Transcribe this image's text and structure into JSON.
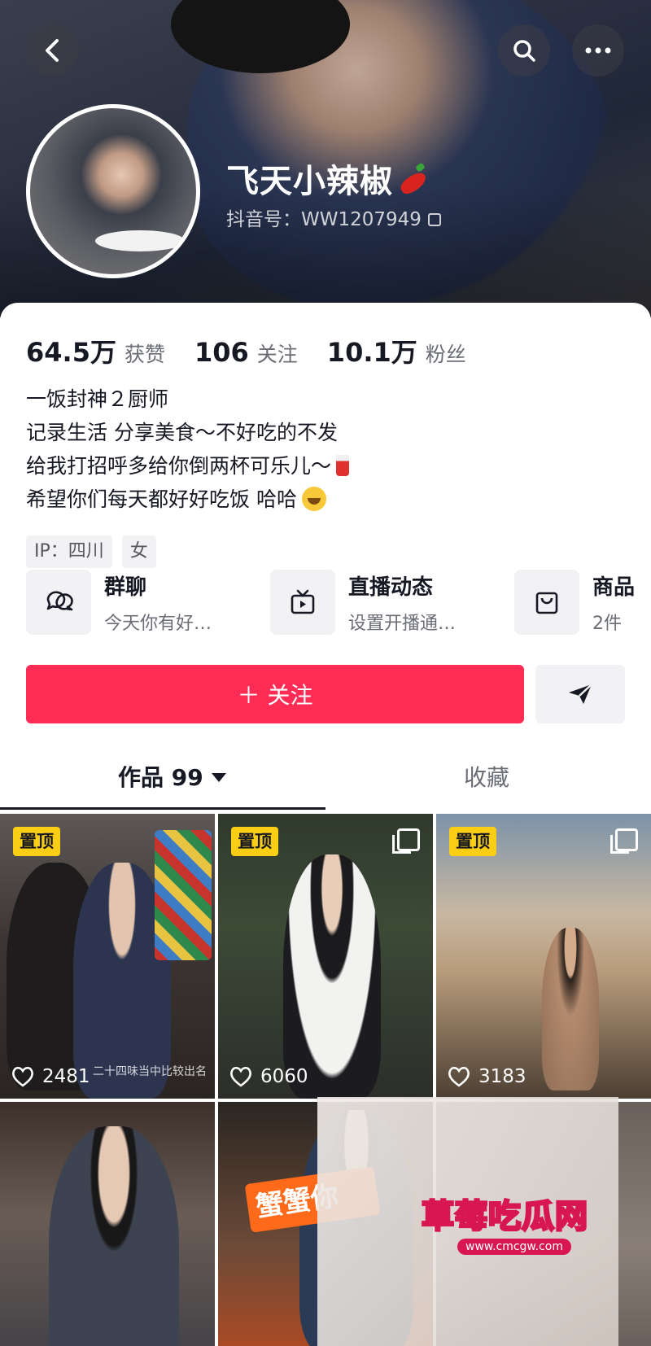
{
  "header": {
    "nickname": "飞天小辣椒",
    "douyin_id": "抖音号：WW1207949"
  },
  "stats": [
    {
      "value": "64.5万",
      "label": "获赞"
    },
    {
      "value": "106",
      "label": "关注"
    },
    {
      "value": "10.1万",
      "label": "粉丝"
    }
  ],
  "bio": {
    "line1": "一饭封神２厨师",
    "line2": "记录生活 分享美食～不好吃的不发",
    "line3": "给我打招呼多给你倒两杯可乐儿～",
    "line4": "希望你们每天都好好吃饭 哈哈"
  },
  "tags": [
    "IP：四川",
    "女"
  ],
  "features": [
    {
      "title": "群聊",
      "subtitle": "今天你有好…",
      "icon": "group-chat-icon"
    },
    {
      "title": "直播动态",
      "subtitle": "设置开播通…",
      "icon": "tv-icon"
    },
    {
      "title": "商品",
      "subtitle": "2件",
      "icon": "shopping-bag-icon"
    }
  ],
  "actions": {
    "follow_label": "＋ 关注"
  },
  "tabs": {
    "works": "作品 99",
    "favorites": "收藏"
  },
  "videos": [
    {
      "pinned": "置顶",
      "likes": "2481",
      "caption": "二十四味当中比较出名"
    },
    {
      "pinned": "置顶",
      "likes": "6060"
    },
    {
      "pinned": "置顶",
      "likes": "3183"
    },
    {},
    {
      "banner": "蟹蟹你"
    },
    {}
  ],
  "watermark": {
    "text": "草莓吃瓜网",
    "url": "www.cmcgw.com"
  }
}
